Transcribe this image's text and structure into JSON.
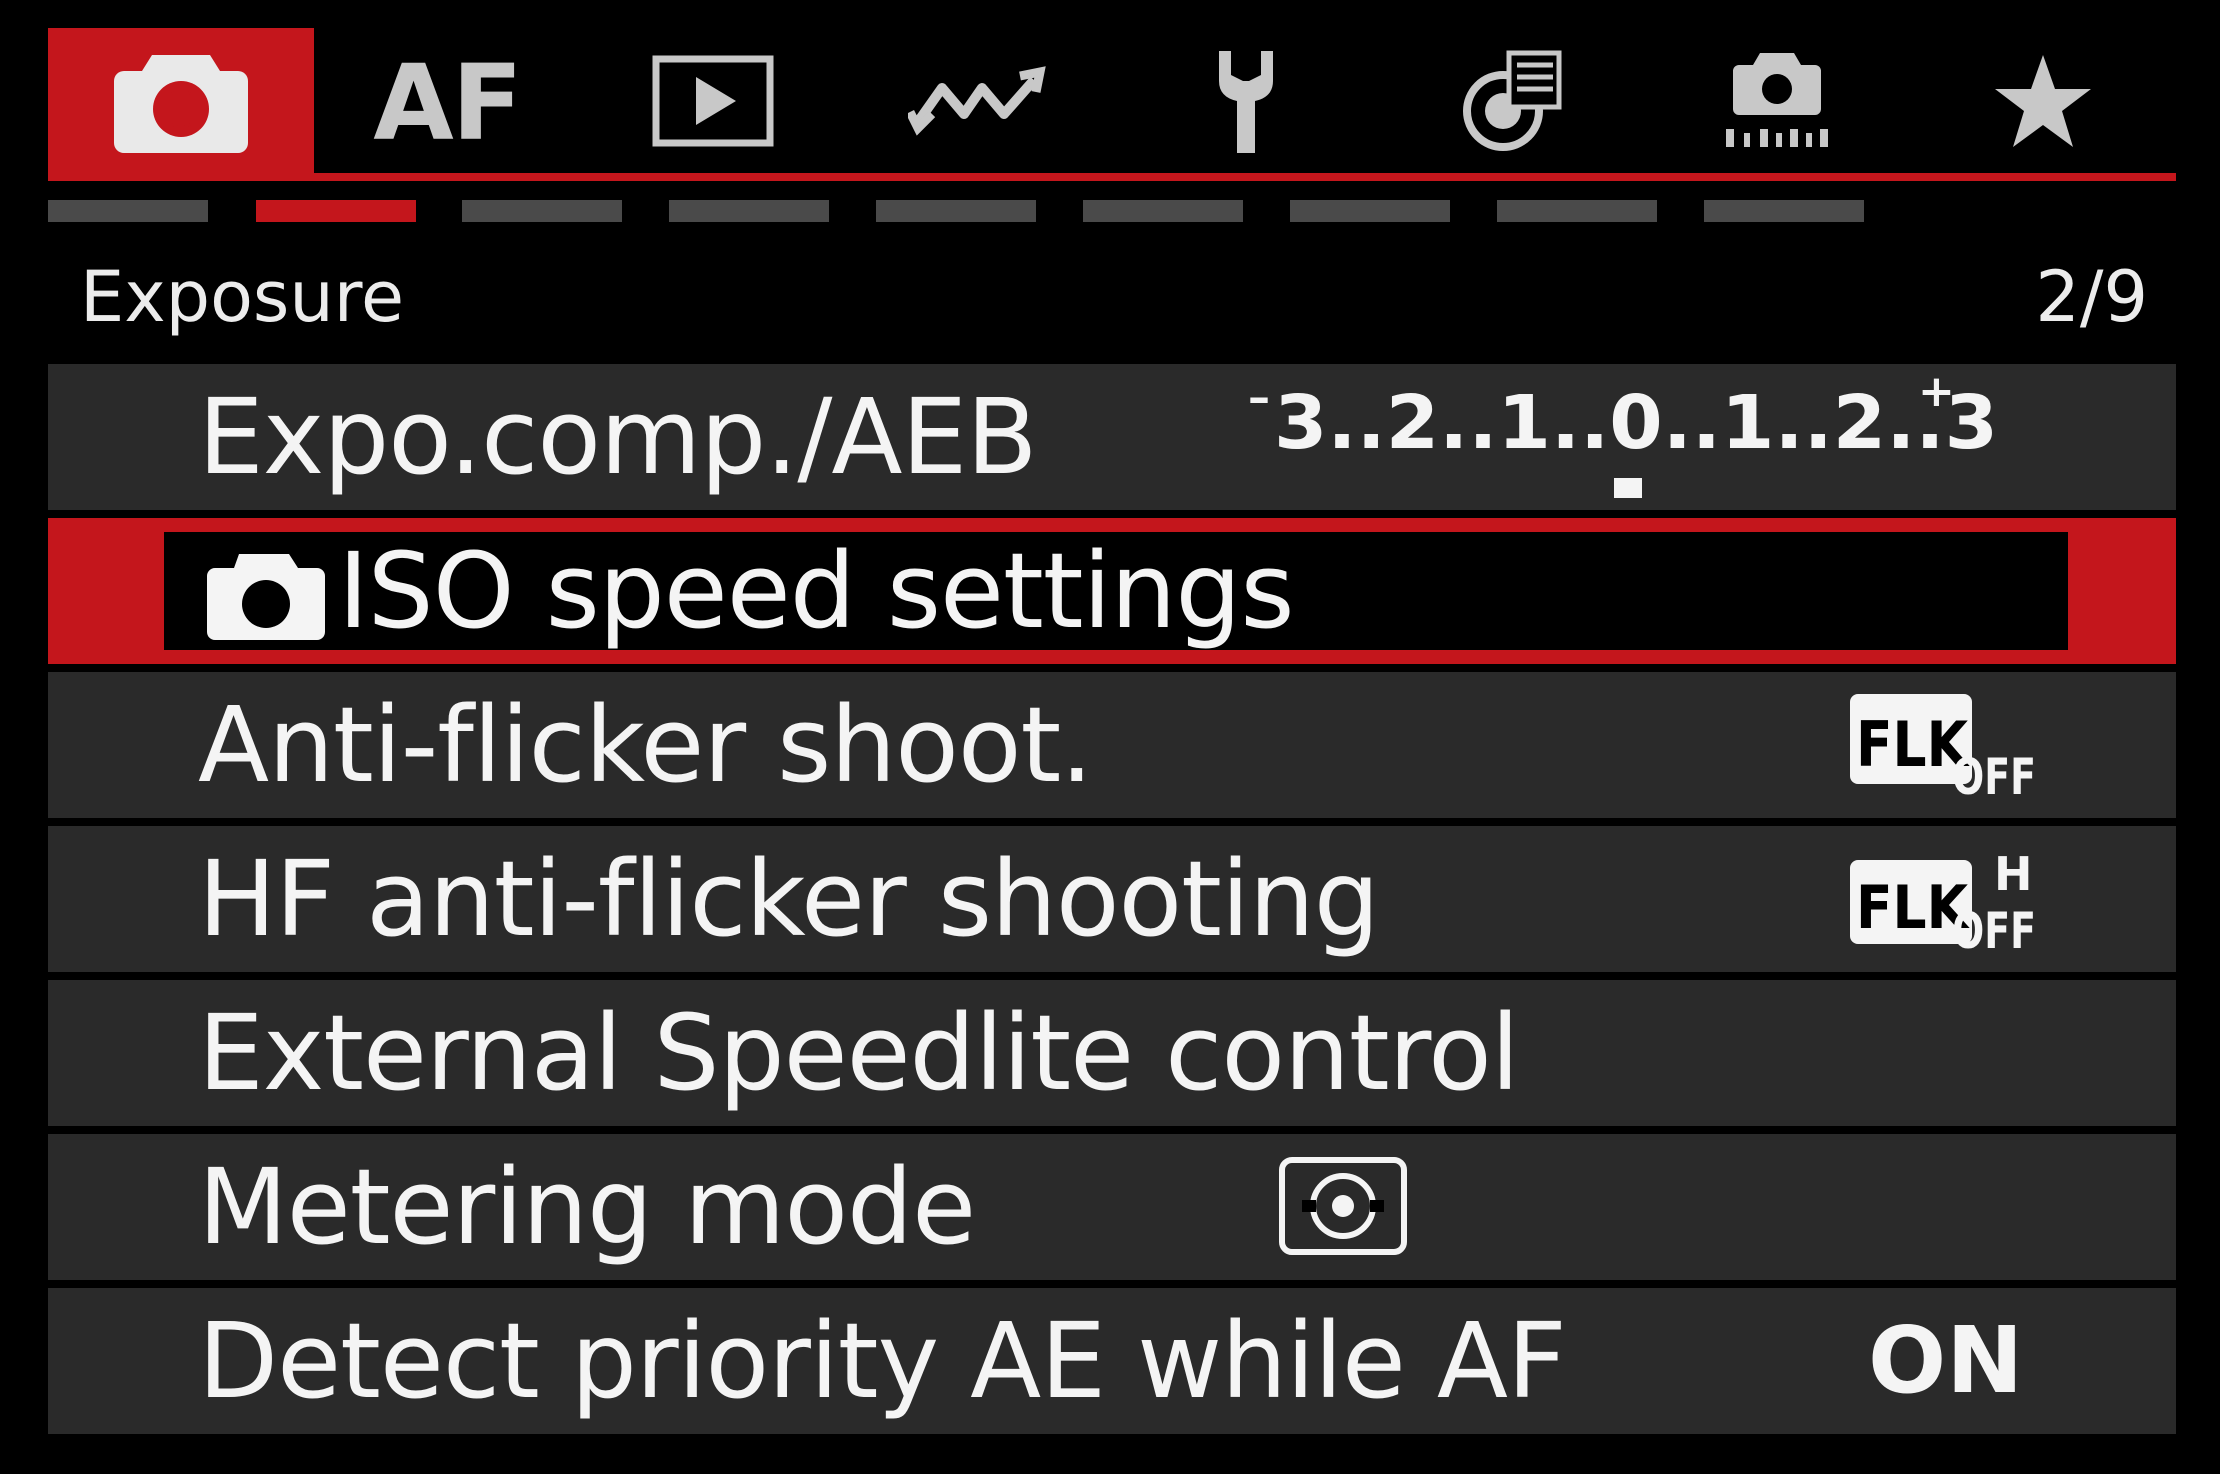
{
  "tabs": [
    {
      "icon": "camera-icon",
      "active": true
    },
    {
      "icon": "af-icon",
      "label": "AF",
      "active": false
    },
    {
      "icon": "playback-icon",
      "active": false
    },
    {
      "icon": "wireless-icon",
      "active": false
    },
    {
      "icon": "wrench-icon",
      "active": false
    },
    {
      "icon": "custom-functions-icon",
      "active": false
    },
    {
      "icon": "my-camera-icon",
      "active": false
    },
    {
      "icon": "star-icon",
      "active": false
    }
  ],
  "page_indicator": {
    "total_pages": 9,
    "current_page": 2
  },
  "section": {
    "title": "Exposure",
    "page": "2/9"
  },
  "menu": {
    "items": [
      {
        "label": "Expo.comp./AEB",
        "value": {
          "minus": "–",
          "scale": "3..2..1..0..1..2..3",
          "plus": "+"
        },
        "selected": false
      },
      {
        "label": "ISO speed settings",
        "icon": "camera-icon",
        "selected": true
      },
      {
        "label": "Anti-flicker shoot.",
        "value": {
          "icon": "flicker-off-icon",
          "text": "FLK",
          "sub": "OFF"
        },
        "selected": false
      },
      {
        "label": "HF anti-flicker shooting",
        "value": {
          "icon": "hf-flicker-off-icon",
          "text": "FLK",
          "super": "H",
          "sub": "OFF"
        },
        "selected": false
      },
      {
        "label": "External Speedlite control",
        "selected": false
      },
      {
        "label": "Metering mode",
        "value": {
          "icon": "evaluative-metering-icon"
        },
        "selected": false
      },
      {
        "label": "Detect priority AE while AF",
        "value": {
          "text": "ON"
        },
        "selected": false
      }
    ]
  },
  "colors": {
    "accent": "#c4161c",
    "row_bg": "#2a2a2a",
    "background": "#000000",
    "text": "#f4f4f4",
    "icon_gray": "#c8c8c8",
    "inactive_bar": "#4a4a4a"
  }
}
